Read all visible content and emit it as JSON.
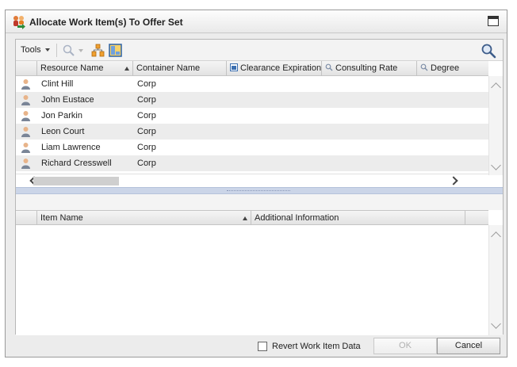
{
  "window": {
    "title": "Allocate Work Item(s) To Offer Set"
  },
  "toolbar": {
    "tools_label": "Tools"
  },
  "resource_grid": {
    "columns": [
      {
        "label": "Resource Name",
        "sort": "asc"
      },
      {
        "label": "Container Name"
      },
      {
        "label": "Clearance Expiration",
        "icon": "calendar-icon"
      },
      {
        "label": "Consulting Rate",
        "icon": "search-icon"
      },
      {
        "label": "Degree",
        "icon": "search-icon"
      }
    ],
    "rows": [
      {
        "name": "Clint Hill",
        "container": "Corp"
      },
      {
        "name": "John Eustace",
        "container": "Corp"
      },
      {
        "name": "Jon Parkin",
        "container": "Corp"
      },
      {
        "name": "Leon Court",
        "container": "Corp"
      },
      {
        "name": "Liam Lawrence",
        "container": "Corp"
      },
      {
        "name": "Richard Cresswell",
        "container": "Corp"
      }
    ]
  },
  "item_grid": {
    "columns": [
      {
        "label": "Item Name",
        "sort": "asc"
      },
      {
        "label": "Additional Information"
      }
    ],
    "rows": []
  },
  "footer": {
    "revert_label": "Revert Work Item Data",
    "revert_checked": false,
    "ok_label": "OK",
    "ok_enabled": false,
    "cancel_label": "Cancel"
  },
  "colors": {
    "alt_row": "#ececec",
    "splitter": "#cbd5e8"
  }
}
